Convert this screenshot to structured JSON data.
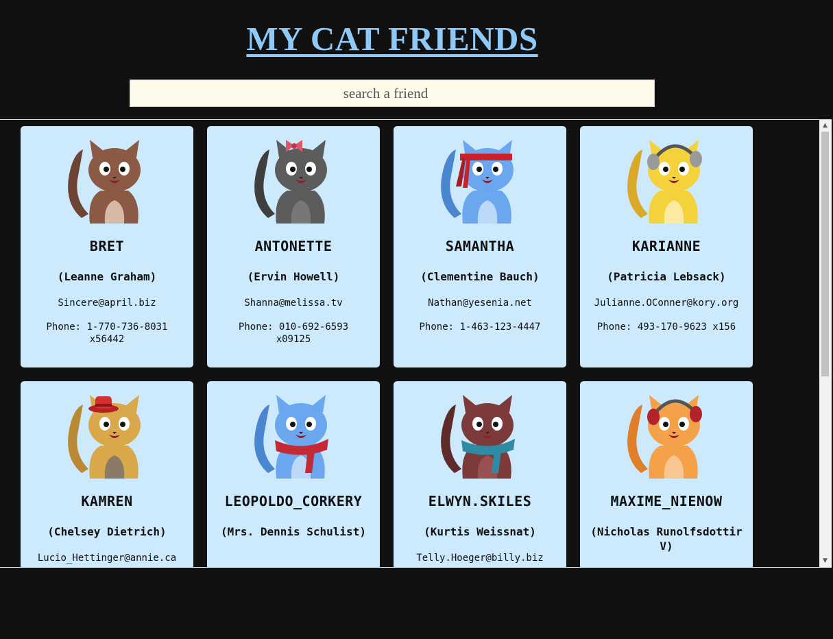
{
  "header": {
    "title": "MY CAT FRIENDS",
    "search_placeholder": "search a friend"
  },
  "cards": [
    {
      "username": "BRET",
      "name": "(Leanne Graham)",
      "email": "Sincere@april.biz",
      "phone": "Phone: 1-770-736-8031 x56442",
      "cat": {
        "icon": "brown-cat-icon",
        "body": "#8a5a45",
        "accent": "#6d4434",
        "belly": "#d8b9a8",
        "acc": "none"
      }
    },
    {
      "username": "ANTONETTE",
      "name": "(Ervin Howell)",
      "email": "Shanna@melissa.tv",
      "phone": "Phone: 010-692-6593 x09125",
      "cat": {
        "icon": "gray-cat-bow-icon",
        "body": "#5c5c5c",
        "accent": "#3f3f3f",
        "belly": "#777777",
        "acc": "bow"
      }
    },
    {
      "username": "SAMANTHA",
      "name": "(Clementine Bauch)",
      "email": "Nathan@yesenia.net",
      "phone": "Phone: 1-463-123-4447",
      "cat": {
        "icon": "blue-cat-headband-icon",
        "body": "#6aa7ee",
        "accent": "#4b86d0",
        "belly": "#bcd9fa",
        "acc": "headband"
      }
    },
    {
      "username": "KARIANNE",
      "name": "(Patricia Lebsack)",
      "email": "Julianne.OConner@kory.org",
      "phone": "Phone: 493-170-9623 x156",
      "cat": {
        "icon": "yellow-cat-headphones-icon",
        "body": "#f4d23b",
        "accent": "#d9a92a",
        "belly": "#fbeaa0",
        "acc": "headphones-gray"
      }
    },
    {
      "username": "KAMREN",
      "name": "(Chelsey Dietrich)",
      "email": "Lucio_Hettinger@annie.ca",
      "phone": "",
      "cat": {
        "icon": "tan-cat-hat-icon",
        "body": "#d9a84a",
        "accent": "#b98a33",
        "belly": "#8a7a66",
        "acc": "hat"
      }
    },
    {
      "username": "LEOPOLDO_CORKERY",
      "name": "(Mrs. Dennis Schulist)",
      "email": "",
      "phone": "",
      "cat": {
        "icon": "blue-cat-scarf-icon",
        "body": "#6aa7ee",
        "accent": "#4b86d0",
        "belly": "#bcd9fa",
        "acc": "scarf-red"
      }
    },
    {
      "username": "ELWYN.SKILES",
      "name": "(Kurtis Weissnat)",
      "email": "Telly.Hoeger@billy.biz",
      "phone": "",
      "cat": {
        "icon": "maroon-cat-scarf-icon",
        "body": "#7c3a3a",
        "accent": "#5e2a2a",
        "belly": "#9a5050",
        "acc": "scarf-teal"
      }
    },
    {
      "username": "MAXIME_NIENOW",
      "name": "(Nicholas Runolfsdottir V)",
      "email": "",
      "phone": "",
      "cat": {
        "icon": "orange-cat-headphones-icon",
        "body": "#f5a14a",
        "accent": "#e07f2a",
        "belly": "#f8c690",
        "acc": "headphones-red"
      }
    }
  ]
}
